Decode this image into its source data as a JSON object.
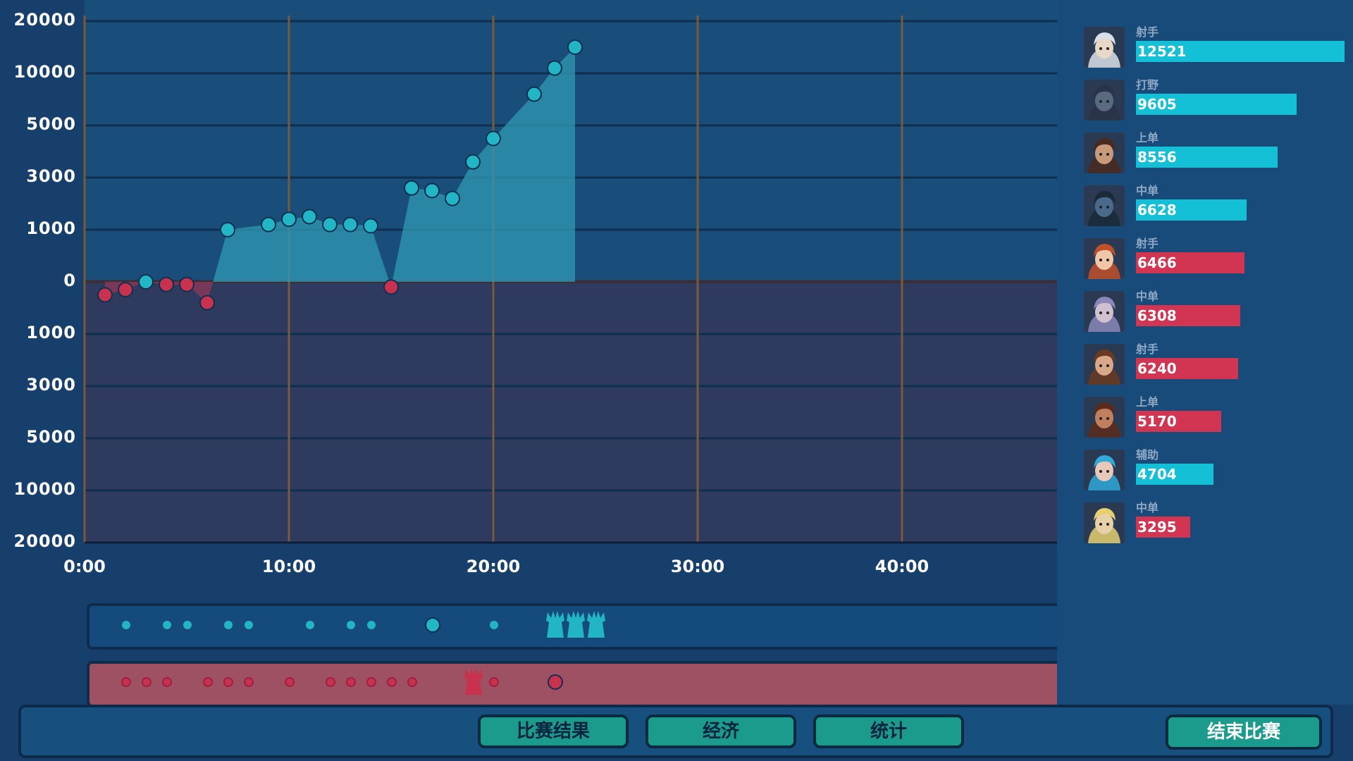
{
  "chart_data": {
    "type": "line",
    "y_tick_labels": [
      "20000",
      "10000",
      "5000",
      "3000",
      "1000",
      "0",
      "1000",
      "3000",
      "5000",
      "10000",
      "20000"
    ],
    "x_tick_labels": [
      "0:00",
      "10:00",
      "20:00",
      "30:00",
      "40:00"
    ],
    "xlim_minutes": [
      0,
      50
    ],
    "grid": true,
    "series": [
      {
        "x": [
          1,
          2,
          3,
          4,
          5,
          6,
          7,
          9,
          10,
          11,
          12,
          13,
          14,
          15,
          16,
          17,
          18,
          19,
          20,
          22,
          23,
          24
        ],
        "y": [
          -250,
          -150,
          0,
          -50,
          -50,
          -400,
          1000,
          1200,
          1400,
          1500,
          1200,
          1200,
          1150,
          -100,
          2600,
          2500,
          2200,
          3600,
          4500,
          8000,
          11000,
          15000
        ],
        "note_positive_color": "#21b5c6",
        "note_negative_color": "#c8324e"
      }
    ]
  },
  "colors": {
    "positive": "#21b5c6",
    "negative": "#c8324e",
    "grid_vertical": "#7a5a3a",
    "chart_top_bg": "#1a4e7a",
    "chart_bottom_bg": "#2e3a5e"
  },
  "timeline": {
    "blue_events": [
      {
        "t": 1,
        "kind": "dot"
      },
      {
        "t": 3,
        "kind": "dot"
      },
      {
        "t": 4,
        "kind": "dot"
      },
      {
        "t": 6,
        "kind": "dot"
      },
      {
        "t": 7,
        "kind": "dot"
      },
      {
        "t": 10,
        "kind": "dot"
      },
      {
        "t": 12,
        "kind": "dot"
      },
      {
        "t": 13,
        "kind": "dot"
      },
      {
        "t": 16,
        "kind": "big"
      },
      {
        "t": 19,
        "kind": "dot"
      },
      {
        "t": 22,
        "kind": "tower"
      },
      {
        "t": 23,
        "kind": "tower"
      },
      {
        "t": 24,
        "kind": "tower"
      }
    ],
    "red_events": [
      {
        "t": 1,
        "kind": "dot"
      },
      {
        "t": 2,
        "kind": "dot"
      },
      {
        "t": 3,
        "kind": "dot"
      },
      {
        "t": 5,
        "kind": "dot"
      },
      {
        "t": 6,
        "kind": "dot"
      },
      {
        "t": 7,
        "kind": "dot"
      },
      {
        "t": 9,
        "kind": "dot"
      },
      {
        "t": 11,
        "kind": "dot"
      },
      {
        "t": 12,
        "kind": "dot"
      },
      {
        "t": 13,
        "kind": "dot"
      },
      {
        "t": 14,
        "kind": "dot"
      },
      {
        "t": 15,
        "kind": "dot"
      },
      {
        "t": 18,
        "kind": "tower"
      },
      {
        "t": 19,
        "kind": "dot"
      },
      {
        "t": 22,
        "kind": "big"
      }
    ]
  },
  "players": [
    {
      "role": "射手",
      "value": "12521",
      "team": "blue",
      "ratio": 1.0,
      "avatar": "elf-archer-avatar",
      "skin": "#e8d8c8",
      "hair": "#d9e0e8"
    },
    {
      "role": "打野",
      "value": "9605",
      "team": "blue",
      "ratio": 0.77,
      "avatar": "armored-knight-avatar",
      "skin": "#5a6a80",
      "hair": "#2a3448"
    },
    {
      "role": "上单",
      "value": "8556",
      "team": "blue",
      "ratio": 0.68,
      "avatar": "red-bandana-warrior-avatar",
      "skin": "#c89a7a",
      "hair": "#4a2a20"
    },
    {
      "role": "中单",
      "value": "6628",
      "team": "blue",
      "ratio": 0.53,
      "avatar": "mech-helmet-avatar",
      "skin": "#4a6a8a",
      "hair": "#1a2a3a"
    },
    {
      "role": "射手",
      "value": "6466",
      "team": "red",
      "ratio": 0.52,
      "avatar": "redhead-girl-avatar",
      "skin": "#f0c8a8",
      "hair": "#c0502a"
    },
    {
      "role": "中单",
      "value": "6308",
      "team": "red",
      "ratio": 0.5,
      "avatar": "silver-hair-mage-avatar",
      "skin": "#d0c0d0",
      "hair": "#8a88b8"
    },
    {
      "role": "射手",
      "value": "6240",
      "team": "red",
      "ratio": 0.49,
      "avatar": "brown-hair-hunter-avatar",
      "skin": "#d8a888",
      "hair": "#6a3a20"
    },
    {
      "role": "上单",
      "value": "5170",
      "team": "red",
      "ratio": 0.41,
      "avatar": "bearded-warrior-avatar",
      "skin": "#c08060",
      "hair": "#5a2a1a"
    },
    {
      "role": "辅助",
      "value": "4704",
      "team": "blue",
      "ratio": 0.37,
      "avatar": "blue-hair-support-avatar",
      "skin": "#e8c8b8",
      "hair": "#30a8d8"
    },
    {
      "role": "中单",
      "value": "3295",
      "team": "red",
      "ratio": 0.26,
      "avatar": "blonde-horned-avatar",
      "skin": "#e8d0a8",
      "hair": "#e8d070"
    }
  ],
  "buttons": {
    "match_result": "比赛结果",
    "economy": "经济",
    "stats": "统计",
    "end_match": "结束比赛"
  }
}
